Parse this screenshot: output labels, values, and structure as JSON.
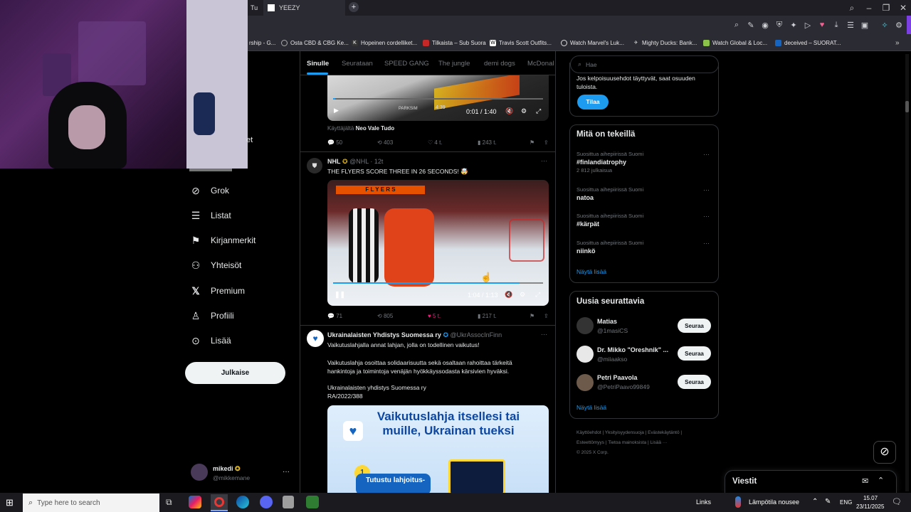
{
  "browser": {
    "tabs": [
      {
        "label": "Tu"
      },
      {
        "label": "YEEZY"
      }
    ],
    "new_tab": "+",
    "bookmarks": [
      {
        "label": "rship - G..."
      },
      {
        "label": "Osta CBD & CBG Ke..."
      },
      {
        "label": "Hopeinen cordelliket..."
      },
      {
        "label": "Tilkaista – Sub Suora"
      },
      {
        "label": "Travis Scott Outfits..."
      },
      {
        "label": "Watch Marvel's Luk..."
      },
      {
        "label": "Mighty Ducks: Bank..."
      },
      {
        "label": "Watch Global & Loc..."
      },
      {
        "label": "deceived – SUORAT..."
      }
    ]
  },
  "nav": {
    "items": [
      {
        "label": "Grok",
        "icon": "grok-icon"
      },
      {
        "label": "Listat",
        "icon": "list-icon"
      },
      {
        "label": "Kirjanmerkit",
        "icon": "bookmark-icon"
      },
      {
        "label": "Yhteisöt",
        "icon": "communities-icon"
      },
      {
        "label": "Premium",
        "icon": "x-icon"
      },
      {
        "label": "Profiili",
        "icon": "profile-icon"
      },
      {
        "label": "Lisää",
        "icon": "more-icon"
      }
    ],
    "post_button": "Julkaise",
    "account": {
      "name": "mikedi",
      "handle": "@mikkemane",
      "more": "···"
    },
    "partial_label": "et"
  },
  "feed_tabs": [
    "Sinulle",
    "Seurataan",
    "SPEED GANG",
    "The jungle",
    "demi dogs",
    "McDonal"
  ],
  "tweets": [
    {
      "video_time": "0:01 / 1:40",
      "badge_left": "PARKSIM",
      "badge_time": "4:39",
      "source_prefix": "Käyttäjältä",
      "source_name": "Neo Vale Tudo",
      "replies": "50",
      "retweets": "403",
      "likes": "4 t.",
      "views": "243 t."
    },
    {
      "name": "NHL",
      "handle": "@NHL · 12t",
      "text": "THE FLYERS SCORE THREE IN 26 SECONDS! 🤯",
      "video_time": "1:04 / 1:13",
      "replies": "71",
      "retweets": "805",
      "likes": "5 t.",
      "views": "217 t.",
      "more": "···"
    },
    {
      "name": "Ukrainalaisten Yhdistys Suomessa ry",
      "handle": "@UkrAssocInFinn",
      "line1": "Vaikutuslahjalla annat lahjan, jolla on todellinen vaikutus!",
      "line2": "Vaikutuslahja osoittaa solidaarisuutta sekä osaltaan rahoittaa tärkeitä hankintoja ja toimintoja venäjän hyökkäyssodasta kärsivien hyväksi.",
      "line3": "Ukrainalaisten yhdistys Suomessa ry",
      "line4": "RA/2022/388",
      "ad_title": "Vaikutuslahja itsellesi tai muille, Ukrainan tueksi",
      "ad_step": "1",
      "ad_step_text": "Tutustu lahjoitus-",
      "more": "···"
    }
  ],
  "right": {
    "search_placeholder": "Hae",
    "sub_text": "Jos kelpoisuusehdot täyttyvät, saat osuuden tuloista.",
    "subscribe": "Tilaa",
    "trending_title": "Mitä on tekeillä",
    "trends": [
      {
        "context": "Suosittua aihepiirissä Suomi",
        "topic": "#finlandiatrophy",
        "count": "2 812 julkaisua"
      },
      {
        "context": "Suosittua aihepiirissä Suomi",
        "topic": "natoa",
        "count": ""
      },
      {
        "context": "Suosittua aihepiirissä Suomi",
        "topic": "#kärpät",
        "count": ""
      },
      {
        "context": "Suosittua aihepiirissä Suomi",
        "topic": "niinkö",
        "count": ""
      }
    ],
    "show_more": "Näytä lisää",
    "follow_title": "Uusia seurattavia",
    "follows": [
      {
        "name": "Matias",
        "handle": "@1masiCS",
        "button": "Seuraa"
      },
      {
        "name": "Dr. Mikko \"Oreshnik\" ...",
        "handle": "@miiaakso",
        "button": "Seuraa"
      },
      {
        "name": "Petri Paavola",
        "handle": "@PetriPaavo99849",
        "button": "Seuraa"
      }
    ],
    "footer": [
      "Käyttöehdot",
      "Yksityisyydensuoja",
      "Evästekäytäntö",
      "Esteettömyys",
      "Tietoa mainoksista",
      "Lisää ···",
      "© 2025 X Corp."
    ],
    "messages": "Viestit"
  },
  "taskbar": {
    "search_placeholder": "Type here to search",
    "links": "Links",
    "weather": "Lämpötila nousee",
    "lang": "ENG",
    "time": "15.07",
    "date": "23/11/2025"
  },
  "colors": {
    "accent": "#1d9bf0",
    "like": "#f91880",
    "gold": "#e2b719"
  }
}
